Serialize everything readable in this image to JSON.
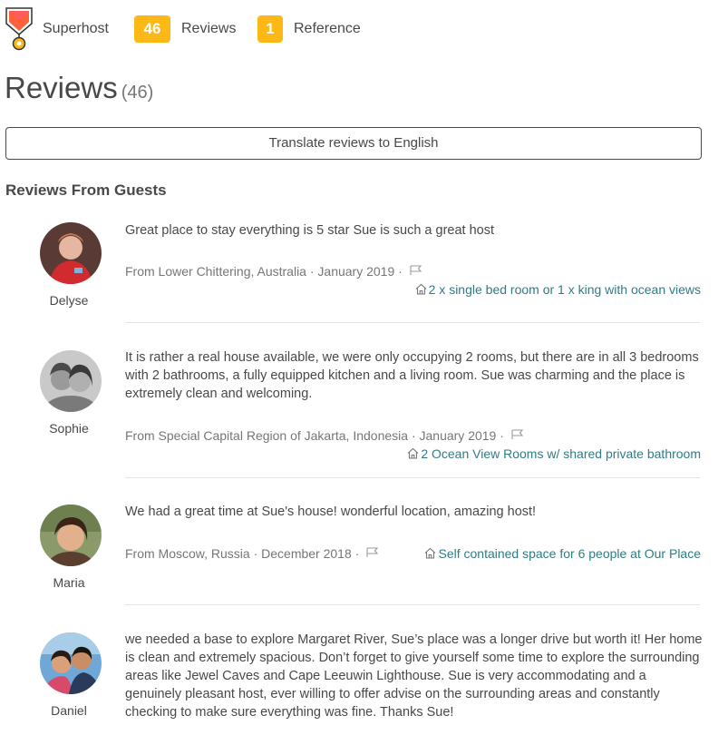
{
  "header": {
    "superhost_label": "Superhost",
    "reviews_count": "46",
    "reviews_label": "Reviews",
    "reference_count": "1",
    "reference_label": "Reference",
    "badge_color": "#fcb814"
  },
  "title": {
    "text": "Reviews",
    "count": "(46)"
  },
  "translate_button": "Translate reviews to English",
  "section_heading": "Reviews From Guests",
  "reviews": [
    {
      "name": "Delyse",
      "text": "Great place to stay everything is 5 star Sue is such a great host",
      "meta": "From Lower Chittering, Australia · January 2019 ·",
      "listing": "2 x single bed room or 1 x king with ocean views"
    },
    {
      "name": "Sophie",
      "text": "It is rather a real house available, we were only occupying 2 rooms, but there are in all 3 bedrooms with 2 bathrooms, a fully equipped kitchen and a living room. Sue was charming and the place is extremely clean and welcoming.",
      "meta": "From Special Capital Region of Jakarta, Indonesia · January 2019 ·",
      "listing": "2 Ocean View Rooms w/ shared private bathroom"
    },
    {
      "name": "Maria",
      "text": "We had a great time at Sue's house! wonderful location, amazing host!",
      "meta": "From Moscow, Russia · December 2018 ·",
      "listing": "Self contained space for 6 people at Our Place"
    },
    {
      "name": "Daniel",
      "text": "we needed a base to explore Margaret River, Sue’s place was a longer drive but worth it! Her home is clean and extremely spacious. Don’t forget to give yourself some time to explore the surrounding areas like Jewel Caves and Cape Leeuwin Lighthouse. Sue is very accommodating and a genuinely pleasant host, ever willing to offer advise on the surrounding areas and constantly checking to make sure everything was fine. Thanks Sue!",
      "meta": "",
      "listing": ""
    }
  ]
}
